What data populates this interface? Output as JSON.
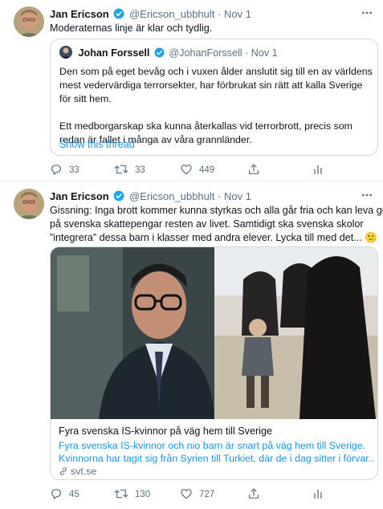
{
  "tweets": [
    {
      "author_name": "Jan Ericson",
      "handle": "@Ericson_ubbhult",
      "separator": "·",
      "date": "Nov 1",
      "more_icon": "more-horizontal-icon",
      "text": "Moderaternas linje är klar och tydlig.",
      "quote": {
        "author_name": "Johan Forssell",
        "handle": "@JohanForssell",
        "separator": "·",
        "date": "Nov 1",
        "paragraph1": "Den som på eget bevåg och i vuxen ålder anslutit sig till en av världens mest vedervärdiga terrorsekter, har förbrukat sin rätt att kalla Sverige för sitt hem.",
        "paragraph2": "Ett medborgarskap ska kunna återkallas vid terrorbrott, precis som redan är fallet i många av våra grannländer.",
        "show_thread": "Show this thread"
      },
      "actions": {
        "replies": "33",
        "retweets": "33",
        "likes": "449"
      }
    },
    {
      "author_name": "Jan Ericson",
      "handle": "@Ericson_ubbhult",
      "separator": "·",
      "date": "Nov 1",
      "more_icon": "more-horizontal-icon",
      "text_line1": "Gissning: Inga brott kommer kunna styrkas och alla går fria och kan leva gott",
      "text_line2": "på svenska skattepengar resten av livet. Samtidigt ska svenska skolor",
      "text_line3": "”integrera” dessa barn i klasser med andra elever. Lycka till med det... 🙁",
      "card": {
        "title": "Fyra svenska IS-kvinnor på väg hem till Sverige",
        "desc_line1": "Fyra svenska IS-kvinnor och nio barn är snart på väg hem till Sverige.",
        "desc_line2": "Kvinnorna har tagit sig från Syrien till Turkiet, där de i dag sitter i förvar....",
        "domain": "svt.se"
      },
      "actions": {
        "replies": "45",
        "retweets": "130",
        "likes": "727"
      }
    }
  ],
  "colors": {
    "link": "#1b95e0",
    "muted": "#5b7083",
    "border": "#cfd9de",
    "verified": "#1da1f2"
  }
}
